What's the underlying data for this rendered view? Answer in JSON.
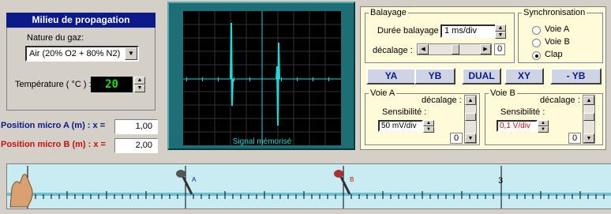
{
  "left": {
    "title": "Milieu de propagation",
    "gas_label": "Nature du gaz:",
    "gas_value": "Air (20% O2 + 80% N2)",
    "temp_label": "Température ( °C ) :",
    "temp_value": "20",
    "pos_a_label": "Position micro A (m) : x =",
    "pos_a_value": "1,00",
    "pos_b_label": "Position micro B (m) : x =",
    "pos_b_value": "2,00"
  },
  "scope": {
    "caption": "Signal mémorisé"
  },
  "balayage": {
    "legend": "Balayage",
    "duree_label": "Durée balayage :",
    "duree_value": "1 ms/div",
    "decalage_label": "décalage :",
    "scroll_value": "0"
  },
  "sync": {
    "legend": "Synchronisation",
    "options": [
      "Voie A",
      "Voie B",
      "Clap"
    ],
    "selected": "Clap"
  },
  "modes": [
    "YA",
    "YB",
    "DUAL",
    "XY",
    "- YB"
  ],
  "voie_a": {
    "legend": "Voie A",
    "decalage_label": "décalage :",
    "sens_label": "Sensibilité :",
    "sens_value": "50 mV/div",
    "scroll_value": "0"
  },
  "voie_b": {
    "legend": "Voie B",
    "decalage_label": "décalage :",
    "sens_label": "Sensibilité :",
    "sens_value": "0,1 V/div",
    "scroll_value": "0"
  },
  "ruler": {
    "mic_a_label": "A",
    "mic_b_label": "B",
    "mark_3": "3"
  },
  "colors": {
    "title_bg": "#0c1a8a",
    "pos_a": "#0c1a8a",
    "pos_b": "#c81010",
    "scope_frame": "#1d6e75",
    "trace": "#20d8d8",
    "lcd_text": "#19e019"
  }
}
